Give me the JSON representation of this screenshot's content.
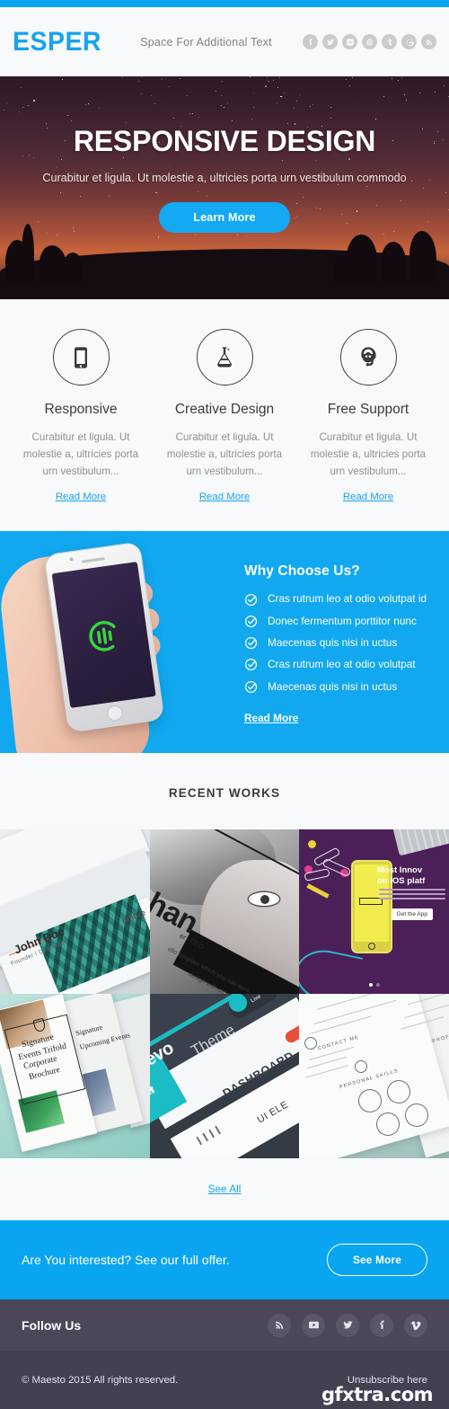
{
  "topbar": {
    "accent_color": "#0aa5f0"
  },
  "header": {
    "logo": "ESPER",
    "tagline": "Space For Additional Text",
    "social": [
      {
        "name": "facebook-icon",
        "label": "Facebook"
      },
      {
        "name": "twitter-icon",
        "label": "Twitter"
      },
      {
        "name": "instagram-icon",
        "label": "Instagram"
      },
      {
        "name": "pinterest-icon",
        "label": "Pinterest"
      },
      {
        "name": "tumblr-icon",
        "label": "Tumblr"
      },
      {
        "name": "google-plus-icon",
        "label": "Google Plus"
      },
      {
        "name": "rss-icon",
        "label": "RSS"
      }
    ]
  },
  "hero": {
    "title": "RESPONSIVE DESIGN",
    "subtitle": "Curabitur et ligula. Ut molestie a, ultricies porta urn vestibulum commodo",
    "button": "Learn More"
  },
  "features": [
    {
      "icon": "mobile-icon",
      "title": "Responsive",
      "text": "Curabitur et ligula. Ut molestie a, ultricies porta urn vestibulum...",
      "link": "Read More"
    },
    {
      "icon": "flask-icon",
      "title": "Creative Design",
      "text": "Curabitur et ligula. Ut molestie a, ultricies porta urn vestibulum...",
      "link": "Read More"
    },
    {
      "icon": "support-headset-icon",
      "title": "Free Support",
      "text": "Curabitur et ligula. Ut molestie a, ultricies porta urn vestibulum...",
      "link": "Read More"
    }
  ],
  "why": {
    "title": "Why Choose Us?",
    "bullets": [
      "Cras rutrum leo at odio volutpat id",
      "Donec fermentum porttitor nunc",
      "Maecenas quis nisi in uctus",
      "Cras rutrum leo at odio volutpat",
      "Maecenas quis nisi in uctus"
    ],
    "link": "Read More",
    "background_color": "#11a8f0"
  },
  "works": {
    "title": "RECENT WORKS",
    "see_all": "See All",
    "tiles": [
      {
        "name": "business-card-mockup",
        "name_text": "John Doe",
        "role_text": "Founder / Developer",
        "brand_text": "umbre"
      },
      {
        "name": "portrait-photo-mockup",
        "headline": "han",
        "role": "er / CEO",
        "caption1": "olio template which you can work,",
        "caption2": "design with ease,"
      },
      {
        "name": "ios-app-promo",
        "headline_line1": "Most Innov",
        "headline_line2": "on iOS platf",
        "button": "Get the App"
      },
      {
        "name": "trifold-brochure-mockup",
        "line1": "Signature",
        "line2": "Events Trifold",
        "line3": "Corporate",
        "line4": "Brochure",
        "side1": "Signature",
        "side2": "Upcoming Events"
      },
      {
        "name": "dashboard-ui-mockup",
        "brand": "evo",
        "brand2": "Theme",
        "label1": "DASHBOARD",
        "label2": "UI ELE",
        "badge": "Live"
      },
      {
        "name": "resume-template-mockup",
        "heading1": "CONTACT ME",
        "heading2": "PERSONAL SKILLS",
        "heading3": "PROFILE"
      }
    ]
  },
  "cta": {
    "text": "Are You interested? See our full offer.",
    "button": "See More",
    "background_color": "#0aa5f0"
  },
  "follow": {
    "title": "Follow Us",
    "social": [
      {
        "name": "rss-icon",
        "label": "RSS"
      },
      {
        "name": "youtube-icon",
        "label": "YouTube"
      },
      {
        "name": "twitter-icon",
        "label": "Twitter"
      },
      {
        "name": "facebook-icon",
        "label": "Facebook"
      },
      {
        "name": "vimeo-icon",
        "label": "Vimeo"
      }
    ]
  },
  "footer": {
    "copyright": "© Maesto 2015 All rights reserved.",
    "unsubscribe": "Unsubscribe here",
    "watermark": "gfxtra.com"
  }
}
